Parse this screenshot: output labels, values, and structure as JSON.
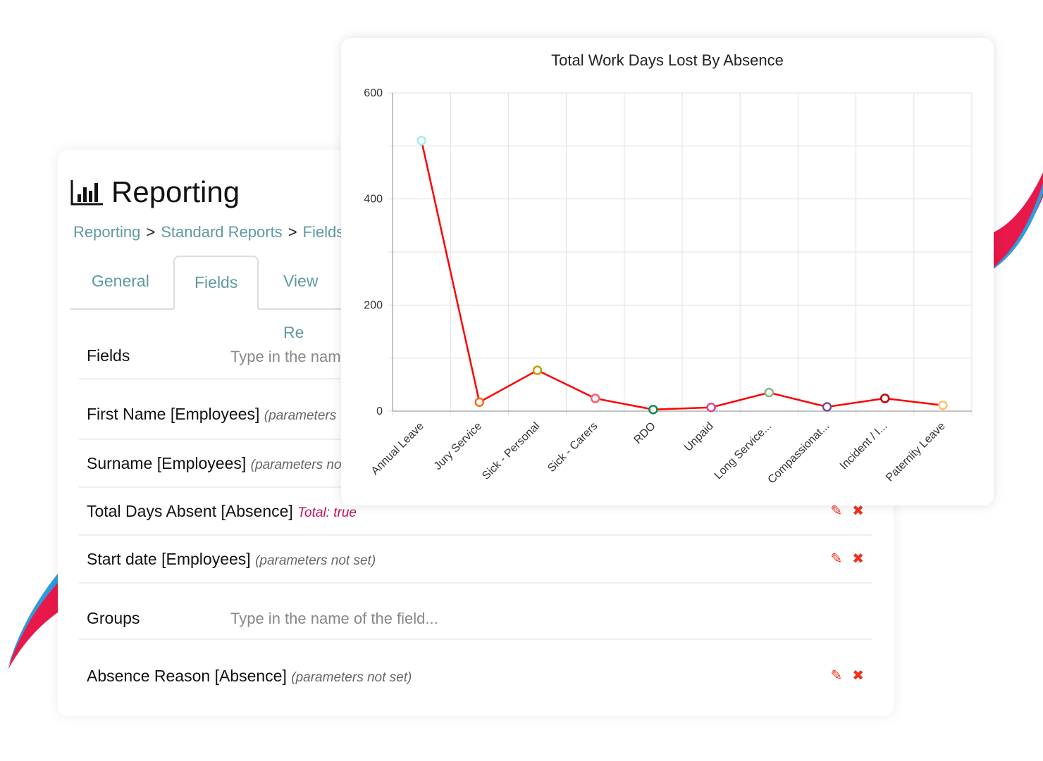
{
  "header": {
    "title": "Reporting",
    "icon": "bar-chart-icon"
  },
  "breadcrumb": [
    "Reporting",
    "Standard Reports",
    "Fields"
  ],
  "breadcrumb_sep": ">",
  "tabs": [
    {
      "label": "General"
    },
    {
      "label": "Fields",
      "active": true
    },
    {
      "label": "View Re"
    }
  ],
  "fields_section": {
    "label": "Fields",
    "placeholder": "Type in the nam"
  },
  "fields": [
    {
      "name": "First Name",
      "table": "[Employees]",
      "note": "(parameters"
    },
    {
      "name": "Surname",
      "table": "[Employees]",
      "note": "(parameters no"
    },
    {
      "name": "Total Days Absent",
      "table": "[Absence]",
      "total": "Total: true"
    },
    {
      "name": "Start date",
      "table": "[Employees]",
      "note": "(parameters not set)"
    }
  ],
  "groups_section": {
    "label": "Groups",
    "placeholder": "Type in the name of the field..."
  },
  "groups": [
    {
      "name": "Absence Reason",
      "table": "[Absence]",
      "note": "(parameters not set)"
    }
  ],
  "action_icons": {
    "edit": "pencil-icon",
    "delete": "close-icon",
    "color": "#f0301a"
  },
  "chart_data": {
    "type": "line",
    "title": "Total Work Days Lost By Absence",
    "categories": [
      "Annual Leave",
      "Jury Service",
      "Sick - Personal",
      "Sick - Carers",
      "RDO",
      "Unpaid",
      "Long Service...",
      "Compassionat...",
      "Incident / I...",
      "Paternity Leave"
    ],
    "values": [
      510,
      17,
      77,
      24,
      3,
      7,
      35,
      8,
      24,
      11
    ],
    "ylim": [
      0,
      600
    ],
    "yticks": [
      0,
      200,
      400,
      600
    ],
    "grid": true,
    "line_color": "#ff0000",
    "point_colors": [
      "#9ef0f0",
      "#ff6a13",
      "#c0a000",
      "#ff5a6e",
      "#0a8a50",
      "#e040a0",
      "#7fb87f",
      "#7a4a9a",
      "#c00000",
      "#ffc070"
    ]
  }
}
